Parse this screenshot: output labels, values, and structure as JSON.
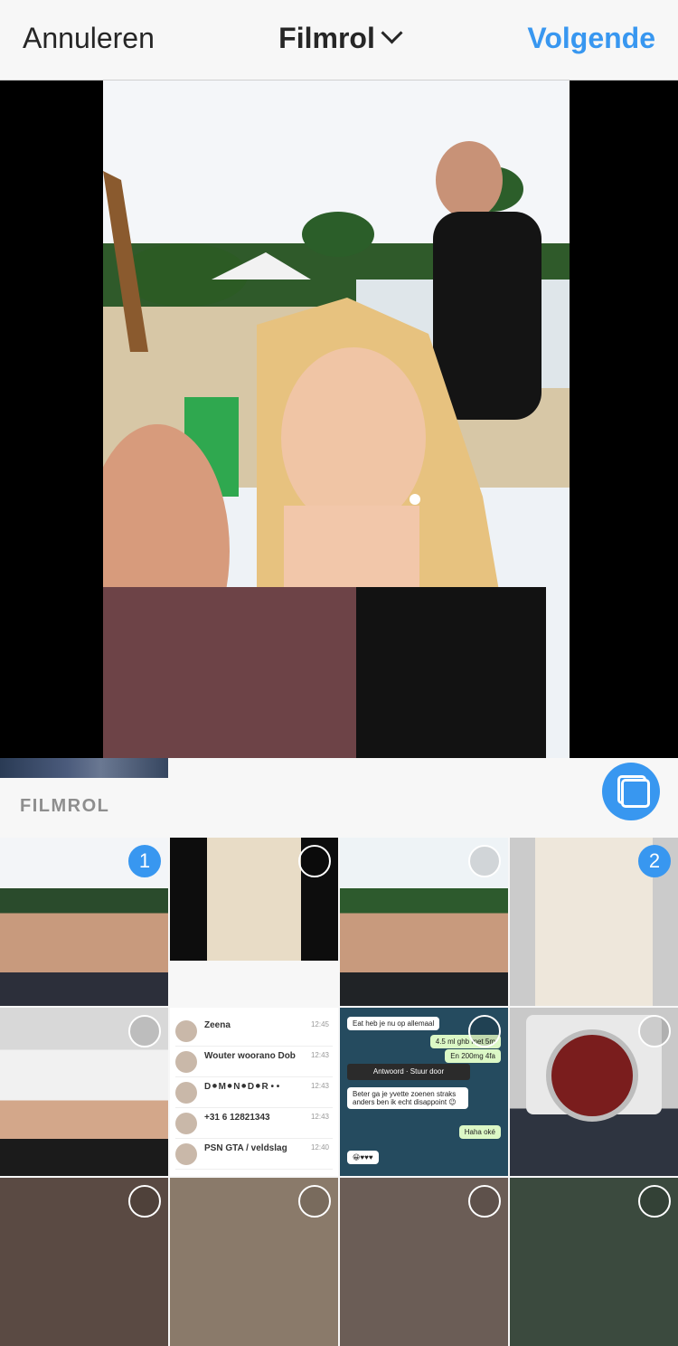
{
  "header": {
    "cancel_label": "Annuleren",
    "title": "Filmrol",
    "next_label": "Volgende"
  },
  "section": {
    "label": "FILMROL"
  },
  "colors": {
    "accent": "#3897f0",
    "header_bg": "#f7f7f7",
    "label_gray": "#8e8e8e"
  },
  "grid": {
    "selection_numbers": [
      "1",
      "2"
    ],
    "chat_preview": {
      "rows": [
        {
          "name": "Zeena",
          "time": "12:45"
        },
        {
          "name": "Wouter woorano Dob",
          "time": "12:43"
        },
        {
          "name": "D⚫M⚫N⚫D⚫R • •",
          "time": "12:43"
        },
        {
          "name": "+31 6 12821343",
          "time": "12:43"
        },
        {
          "name": "PSN GTA / veldslag",
          "time": "12:40"
        }
      ]
    },
    "wa_preview": {
      "bubbles": [
        {
          "text": "Eat heb je nu op allemaal",
          "side": "in"
        },
        {
          "text": "4.5 ml ghb met 5m ",
          "side": "out"
        },
        {
          "text": "En 200mg 4fa",
          "side": "out"
        },
        {
          "text": "Beter ga je yvette zoenen straks anders ben ik echt disappoint 😉",
          "side": "in"
        },
        {
          "text": "Haha oké",
          "side": "out"
        },
        {
          "text": "😀♥♥♥",
          "side": "in"
        }
      ],
      "actions": [
        "Antwoord",
        "Stuur door"
      ]
    }
  }
}
